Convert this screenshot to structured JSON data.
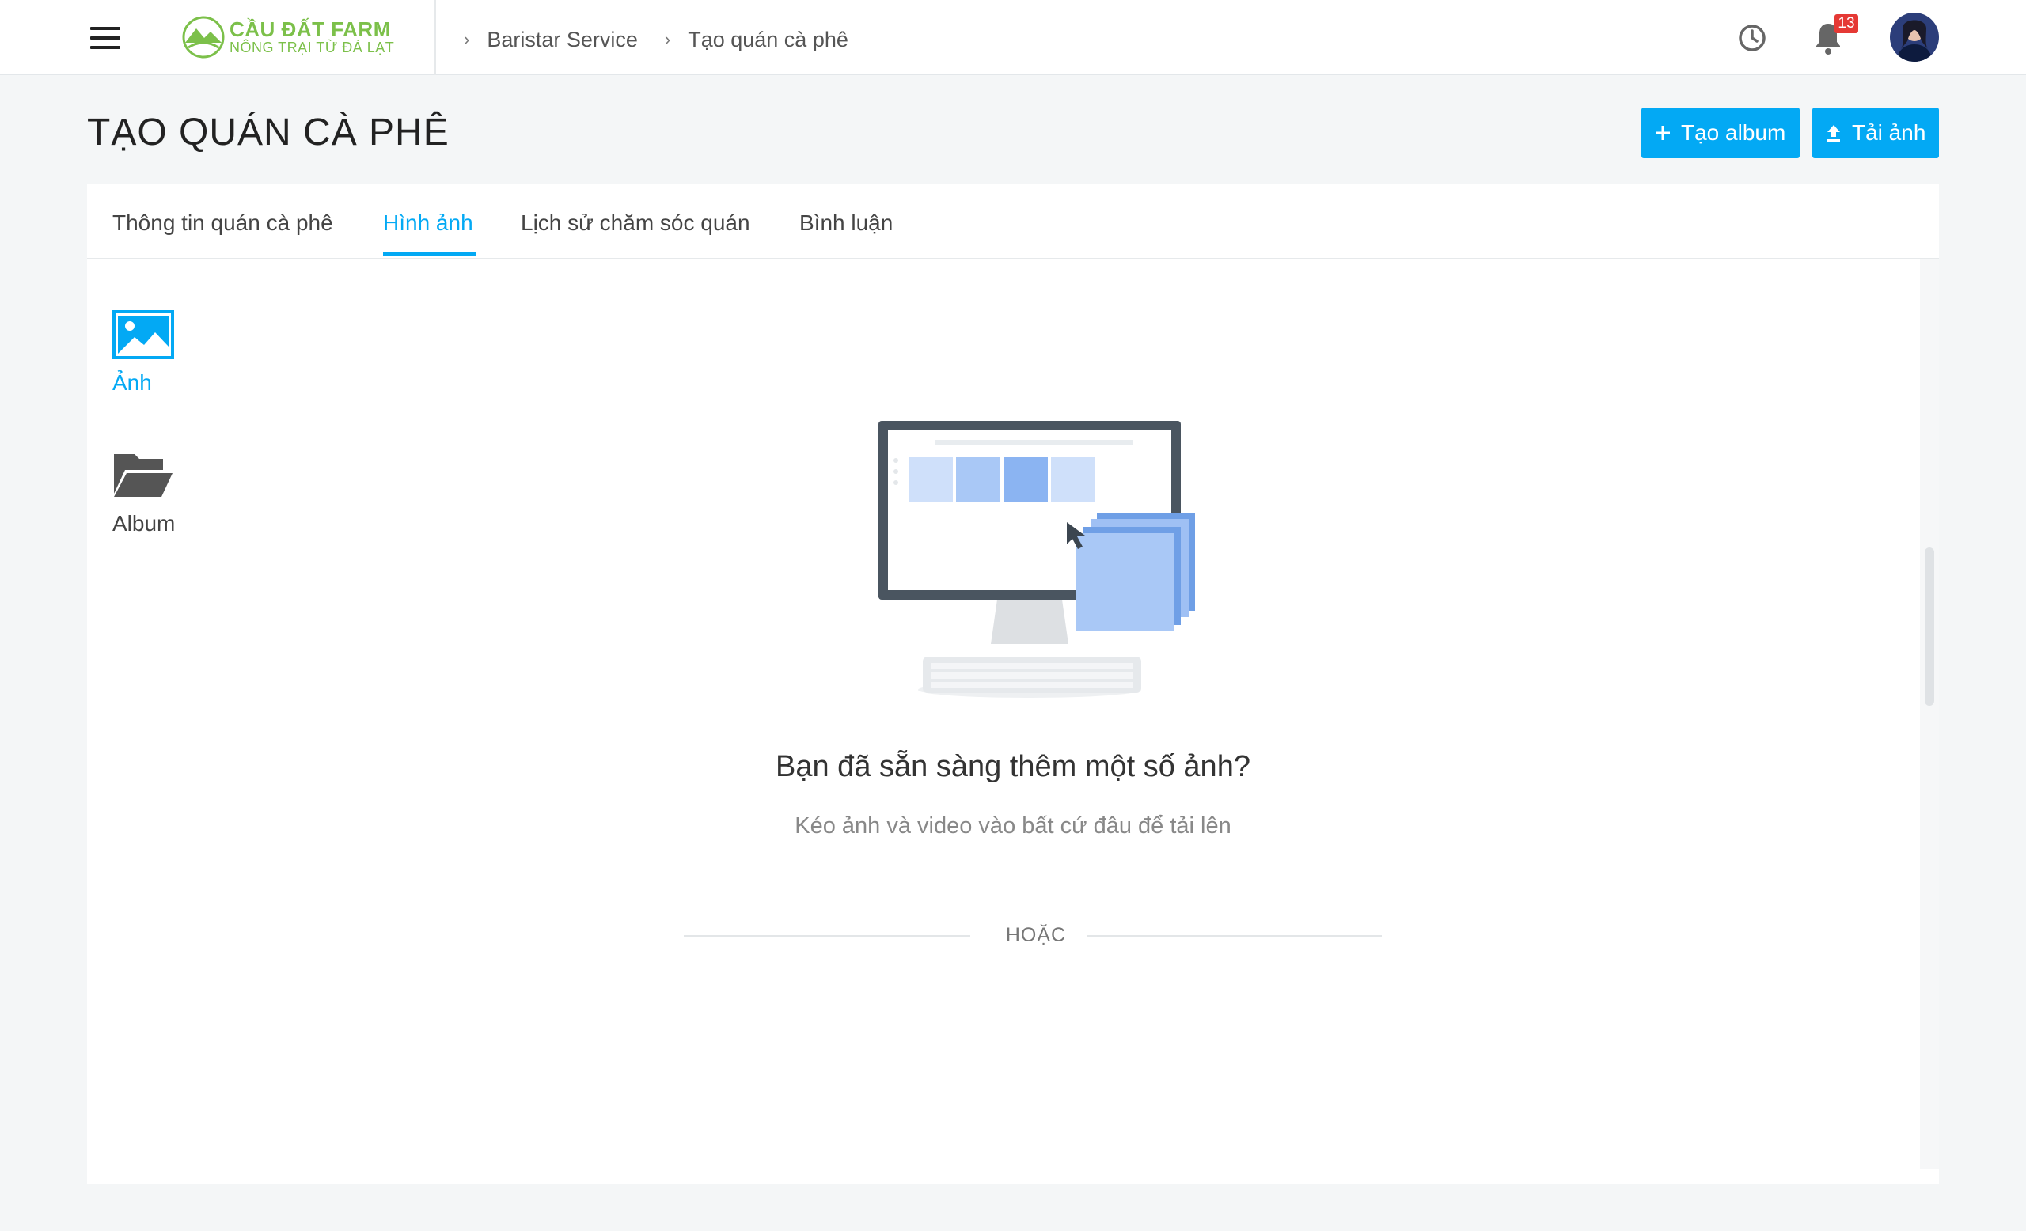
{
  "header": {
    "logo": {
      "name": "CẦU ĐẤT FARM",
      "tagline": "NÔNG TRẠI TỪ ĐÀ LẠT"
    },
    "breadcrumb": [
      {
        "sep": "›",
        "label": "Baristar Service"
      },
      {
        "sep": "›",
        "label": "Tạo quán cà phê"
      }
    ],
    "notification_count": "13",
    "icons": [
      "menu-icon",
      "clock-icon",
      "bell-icon",
      "avatar"
    ]
  },
  "page": {
    "title": "TẠO QUÁN CÀ PHÊ",
    "create_album_label": "Tạo album",
    "upload_label": "Tải ảnh"
  },
  "tabs": [
    {
      "label": "Thông tin quán cà phê",
      "active": false
    },
    {
      "label": "Hình ảnh",
      "active": true
    },
    {
      "label": "Lịch sử chăm sóc quán",
      "active": false
    },
    {
      "label": "Bình luận",
      "active": false
    }
  ],
  "sidebar": [
    {
      "label": "Ảnh",
      "icon": "image-icon",
      "active": true
    },
    {
      "label": "Album",
      "icon": "folder-open-icon",
      "active": false
    }
  ],
  "empty_state": {
    "headline": "Bạn đã sẵn sàng thêm một số ảnh?",
    "subline": "Kéo ảnh và video vào bất cứ đâu để tải lên",
    "or_label": "HOẶC"
  },
  "colors": {
    "accent": "#03a9f4",
    "brand": "#7cc04a",
    "badge": "#e53935"
  }
}
